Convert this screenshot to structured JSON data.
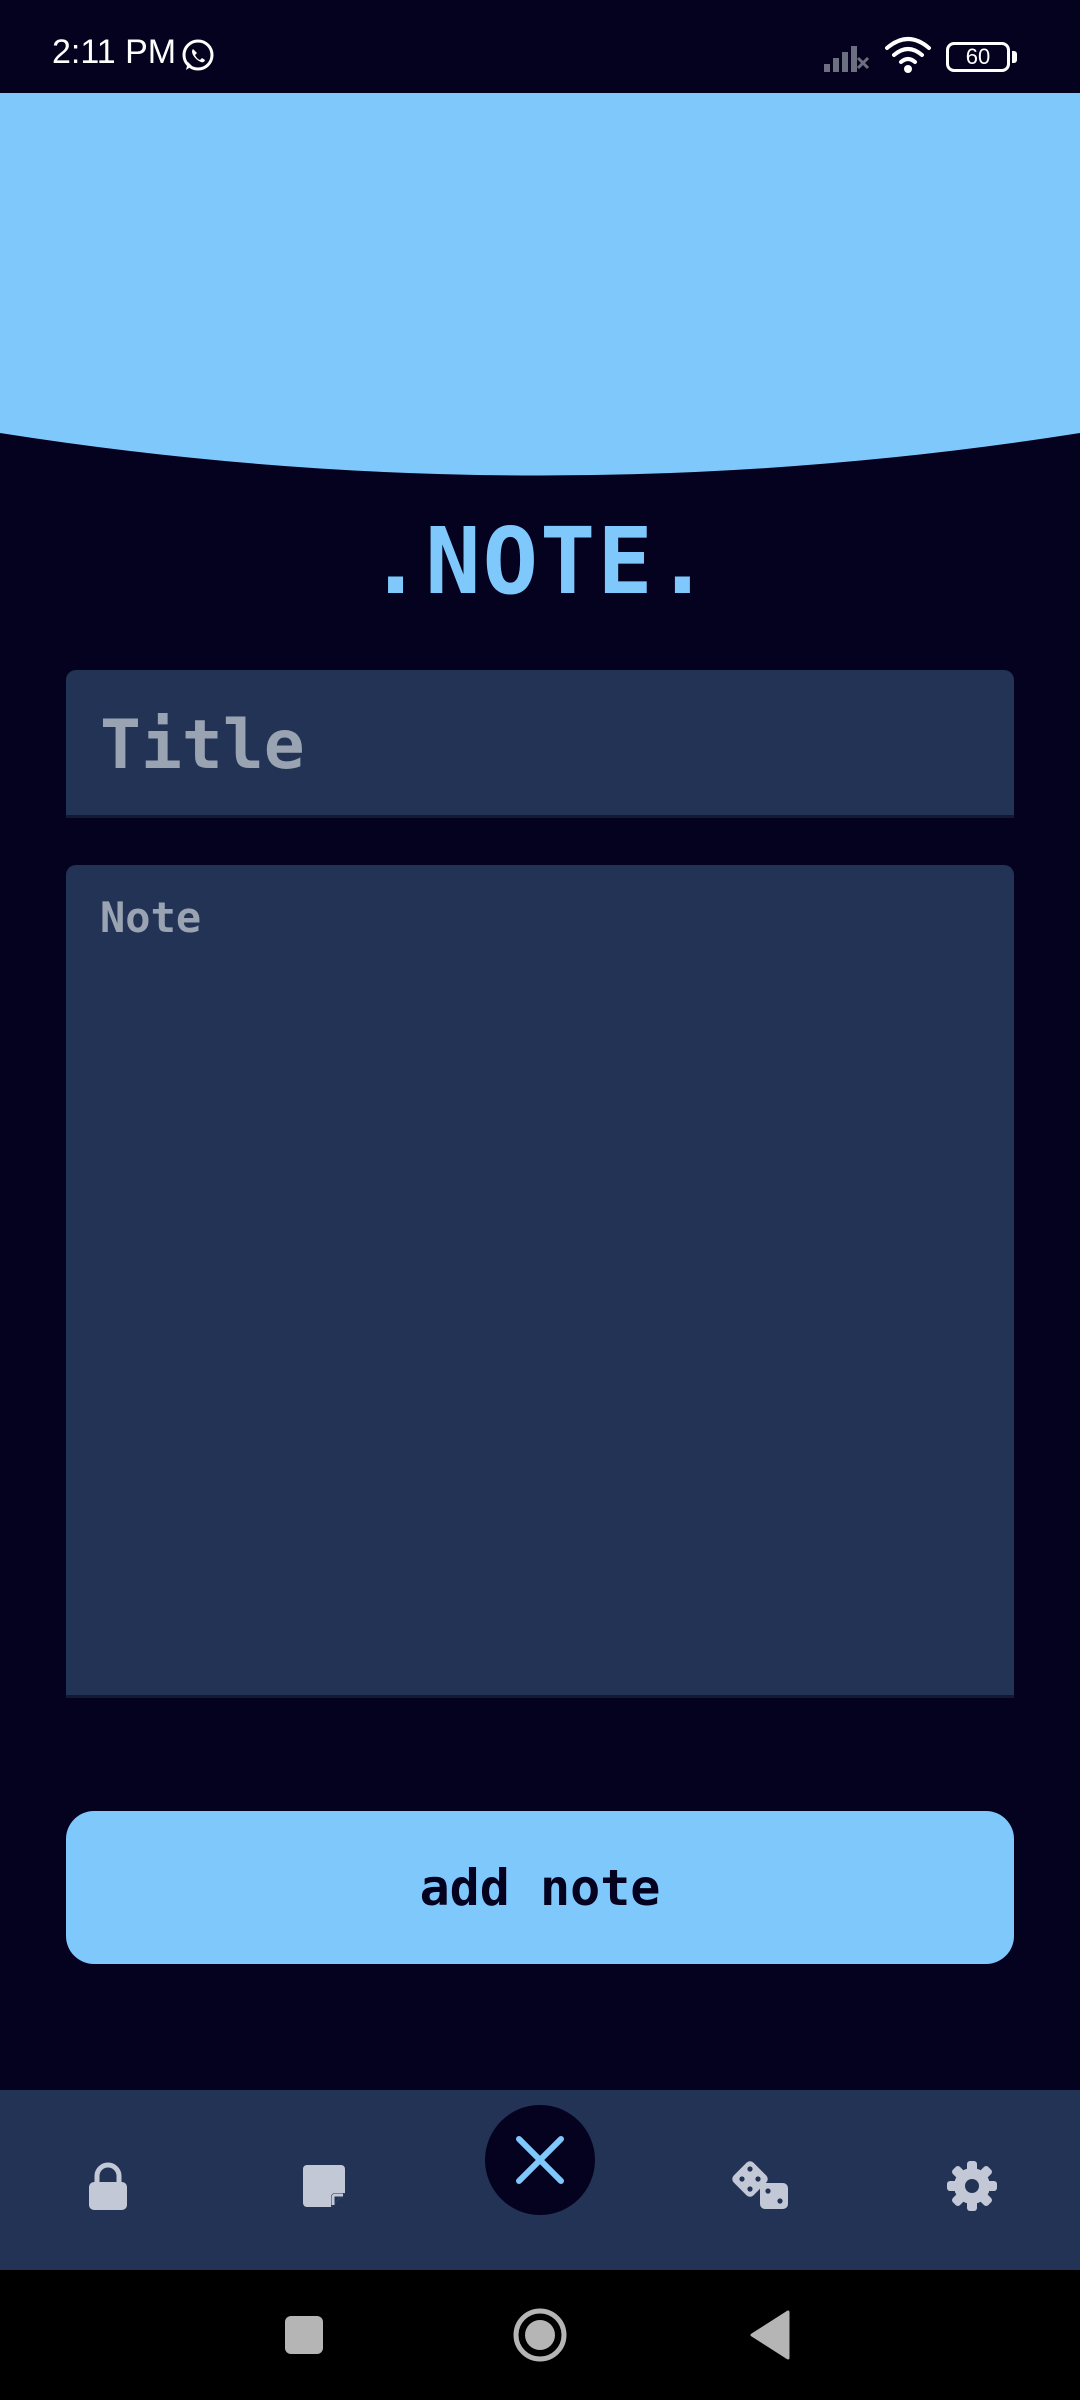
{
  "status_bar": {
    "time": "2:11 PM",
    "battery": "60",
    "icons": [
      "whatsapp-icon",
      "signal-icon",
      "wifi-icon",
      "battery-icon"
    ]
  },
  "header": {
    "app_title": ".NOTE."
  },
  "form": {
    "title_placeholder": "Title",
    "title_value": "",
    "note_placeholder": "Note",
    "note_value": "",
    "add_button_label": "add note"
  },
  "bottom_nav": {
    "items": [
      {
        "name": "lock-icon"
      },
      {
        "name": "note-icon"
      },
      {
        "name": "close-icon",
        "active": true
      },
      {
        "name": "dice-icon"
      },
      {
        "name": "settings-icon"
      }
    ]
  },
  "system_nav": {
    "buttons": [
      "recents-button",
      "home-button",
      "back-button"
    ]
  },
  "colors": {
    "background": "#05021f",
    "accent": "#7ec8fc",
    "surface": "#223355",
    "placeholder": "#9aa3b2",
    "nav_icon": "#c3c8d6"
  }
}
